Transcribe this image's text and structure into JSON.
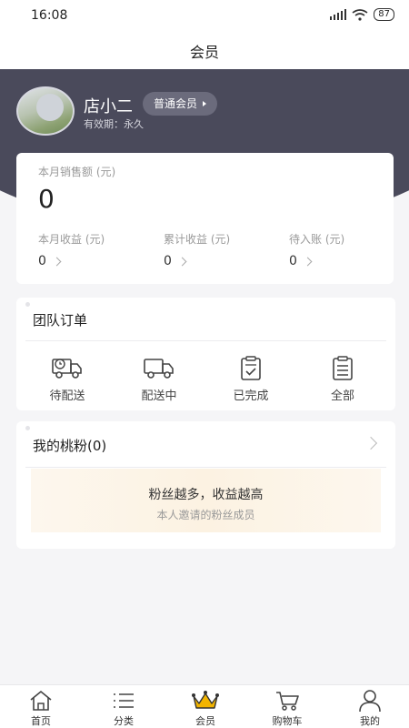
{
  "status_bar": {
    "time": "16:08",
    "battery": "87"
  },
  "nav": {
    "title": "会员"
  },
  "profile": {
    "username": "店小二",
    "member_level": "普通会员",
    "validity": "有效期：永久"
  },
  "sales": {
    "label": "本月销售额 (元)",
    "value": "0",
    "stats": [
      {
        "label": "本月收益 (元)",
        "value": "0"
      },
      {
        "label": "累计收益 (元)",
        "value": "0"
      },
      {
        "label": "待入账 (元)",
        "value": "0"
      }
    ]
  },
  "team_orders": {
    "title": "团队订单",
    "items": [
      {
        "label": "待配送",
        "icon": "truck-clock-icon"
      },
      {
        "label": "配送中",
        "icon": "truck-icon"
      },
      {
        "label": "已完成",
        "icon": "clipboard-check-icon"
      },
      {
        "label": "全部",
        "icon": "clipboard-list-icon"
      }
    ]
  },
  "fans": {
    "title": "我的桃粉(0)",
    "headline": "粉丝越多，收益越高",
    "subtitle": "本人邀请的粉丝成员"
  },
  "tabbar": {
    "items": [
      {
        "label": "首页",
        "icon": "home-icon"
      },
      {
        "label": "分类",
        "icon": "category-list-icon"
      },
      {
        "label": "会员",
        "icon": "crown-icon"
      },
      {
        "label": "购物车",
        "icon": "cart-icon"
      },
      {
        "label": "我的",
        "icon": "user-icon"
      }
    ]
  },
  "colors": {
    "header": "#4a4a5b",
    "background": "#f5f5f7",
    "crown": "#f2b400"
  }
}
